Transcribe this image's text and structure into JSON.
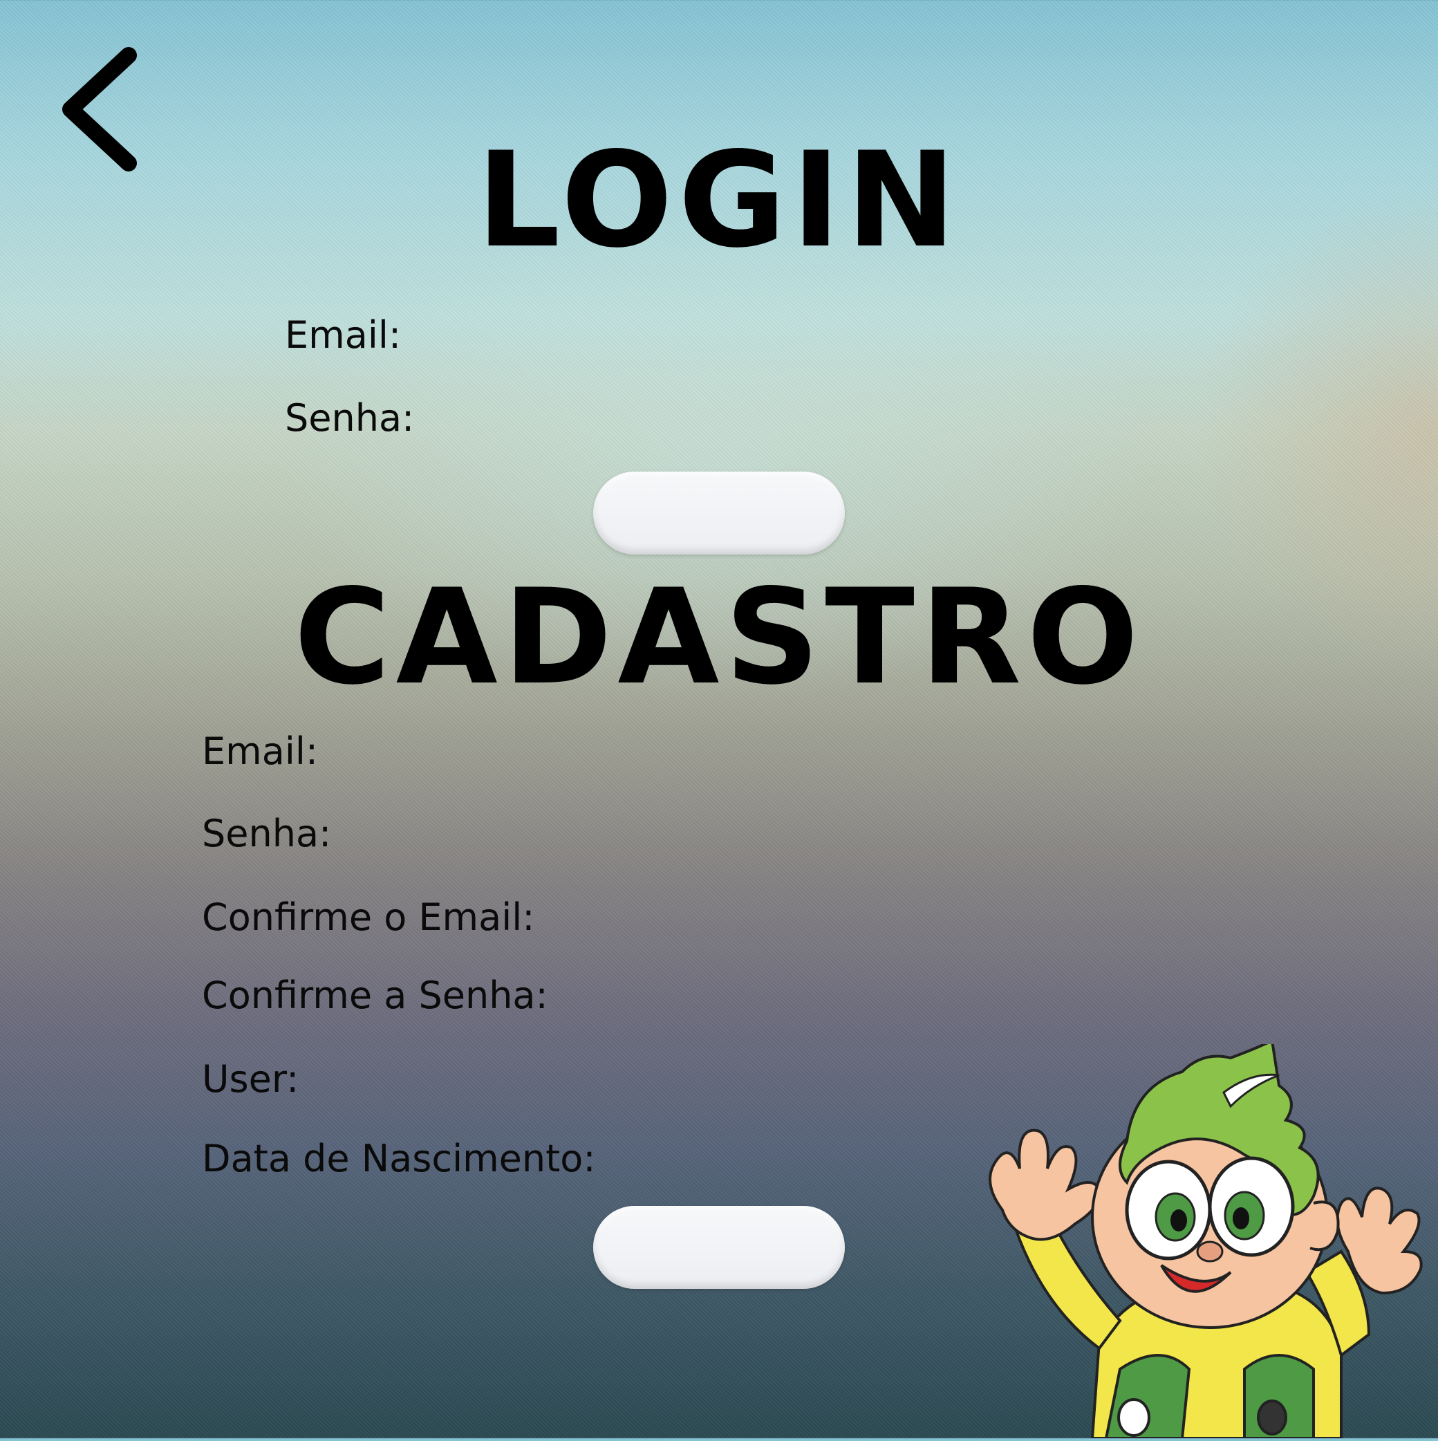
{
  "navigation": {
    "back_icon": "chevron-left-icon"
  },
  "login": {
    "title": "LOGIN",
    "fields": [
      {
        "label": "Email:"
      },
      {
        "label": "Senha:"
      }
    ],
    "submit_label": ""
  },
  "cadastro": {
    "title": "CADASTRO",
    "fields": [
      {
        "label": "Email:"
      },
      {
        "label": "Senha:"
      },
      {
        "label": "Confirme o Email:"
      },
      {
        "label": "Confirme a Senha:"
      },
      {
        "label": "User:"
      },
      {
        "label": "Data de Nascimento:"
      }
    ],
    "submit_label": ""
  },
  "mascot": {
    "icon": "cartoon-boy-mascot"
  },
  "colors": {
    "text": "#000000",
    "button": "#eef0f3",
    "background_top": "#86c3d4",
    "background_bottom": "#2b4a52"
  }
}
